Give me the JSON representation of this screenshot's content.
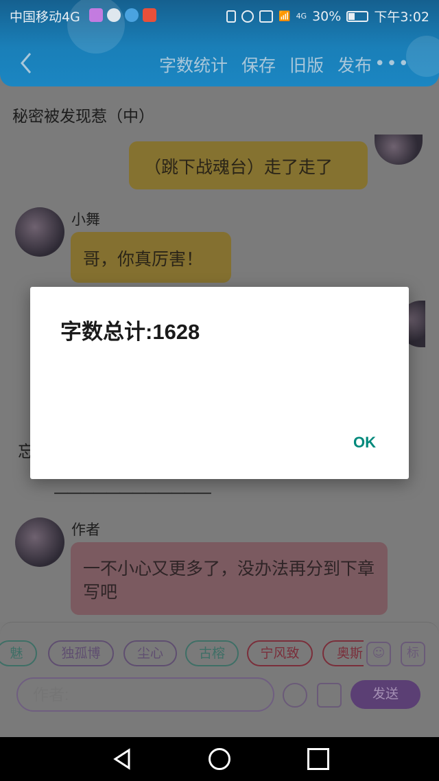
{
  "status_bar": {
    "carrier": "中国移动4G",
    "network_type": "4G",
    "battery": "30%",
    "time": "下午3:02",
    "app_icons": [
      "photos-icon",
      "message-icon",
      "browser-icon",
      "badge-100-icon"
    ]
  },
  "header": {
    "back_icon": "chevron-left-icon",
    "actions": [
      "字数统计",
      "保存",
      "旧版",
      "发布"
    ],
    "more_icon": "more-dots-icon"
  },
  "chat": {
    "chapter_title": "秘密被发现惹（中）",
    "messages": [
      {
        "side": "right",
        "text": "（跳下战魂台）走了走了"
      },
      {
        "side": "left",
        "name": "小舞",
        "text": "哥，你真厉害！"
      },
      {
        "side": "left",
        "name": "作者",
        "text": "一不小心又更多了，没办法再分到下章写吧"
      }
    ],
    "partial_text": "忘",
    "divider_text": "————————————"
  },
  "input_panel": {
    "character_chips": [
      "魅",
      "独孤博",
      "尘心",
      "古榕",
      "宁风致",
      "奥斯"
    ],
    "author_placeholder": "作者:",
    "send_label": "发送",
    "tag_label": "标"
  },
  "dialog": {
    "message": "字数总计:1628",
    "ok_label": "OK"
  },
  "colors": {
    "header_blue": "#1b86c2",
    "dialog_ok": "#00897b",
    "send_button": "#5b3f74"
  }
}
